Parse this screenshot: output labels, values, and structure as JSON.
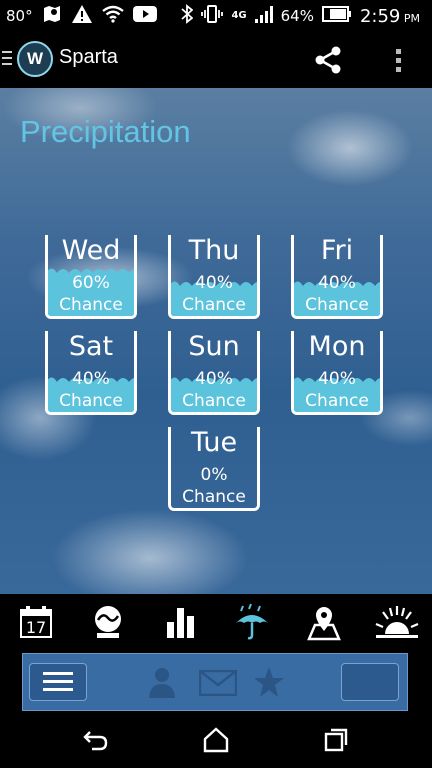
{
  "status_bar": {
    "temperature": "80°",
    "battery_percent": "64%",
    "time": "2:59",
    "ampm": "PM",
    "network": "4G"
  },
  "app_bar": {
    "logo_text": "W",
    "title": "Sparta"
  },
  "page": {
    "title": "Precipitation"
  },
  "forecast": [
    {
      "day": "Wed",
      "chance": "60%",
      "label": "Chance",
      "fill": 0.6
    },
    {
      "day": "Thu",
      "chance": "40%",
      "label": "Chance",
      "fill": 0.4
    },
    {
      "day": "Fri",
      "chance": "40%",
      "label": "Chance",
      "fill": 0.4
    },
    {
      "day": "Sat",
      "chance": "40%",
      "label": "Chance",
      "fill": 0.4
    },
    {
      "day": "Sun",
      "chance": "40%",
      "label": "Chance",
      "fill": 0.4
    },
    {
      "day": "Mon",
      "chance": "40%",
      "label": "Chance",
      "fill": 0.4
    },
    {
      "day": "Tue",
      "chance": "0%",
      "label": "Chance",
      "fill": 0.0
    }
  ],
  "tabs": {
    "calendar_day": "17",
    "active": "precipitation"
  },
  "colors": {
    "accent": "#63c5e4",
    "water": "#5bc3dc",
    "active_tab": "#5bc3dc"
  }
}
